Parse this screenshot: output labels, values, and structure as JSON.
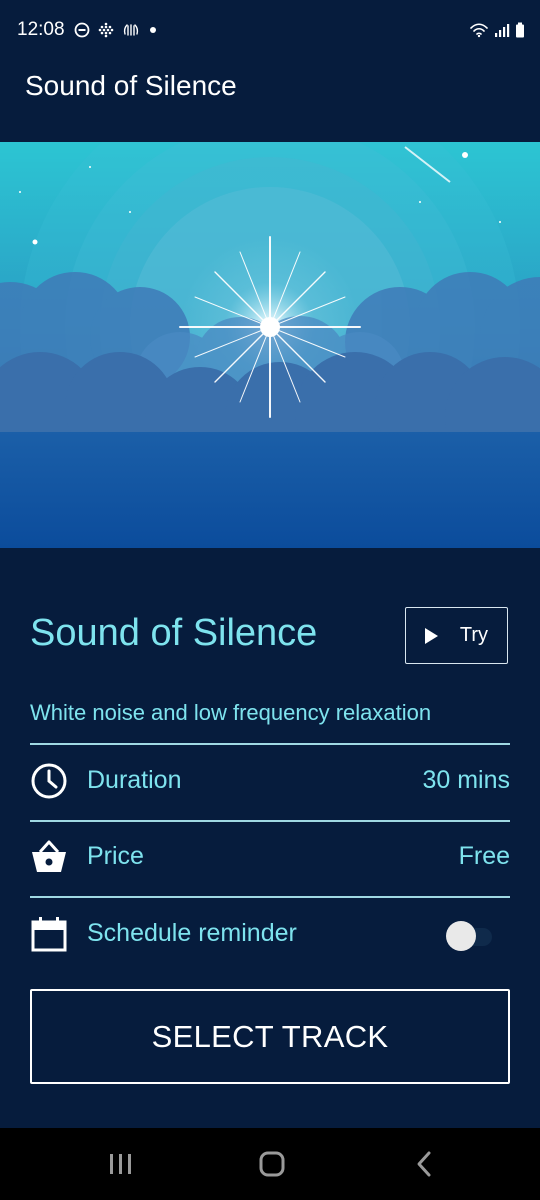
{
  "status_bar": {
    "time": "12:08",
    "left_icons": [
      "do-not-disturb-icon",
      "app-grid-icon",
      "hand-icon",
      "dot-icon"
    ],
    "right_icons": [
      "wifi-icon",
      "signal-icon",
      "battery-icon"
    ]
  },
  "app_bar": {
    "title": "Sound of Silence"
  },
  "hero": {
    "icon": "starburst-clouds-illustration"
  },
  "track": {
    "title": "Sound of Silence",
    "try_label": "Try",
    "description": "White noise and low frequency relaxation"
  },
  "details": {
    "duration_label": "Duration",
    "duration_value": "30 mins",
    "price_label": "Price",
    "price_value": "Free",
    "reminder_label": "Schedule reminder",
    "reminder_enabled": false
  },
  "actions": {
    "select_label": "SELECT TRACK"
  },
  "nav": {
    "items": [
      "recents-icon",
      "home-icon",
      "back-icon"
    ]
  },
  "colors": {
    "background": "#061c3d",
    "accent": "#7ee3ee",
    "divider": "#9fd8e3"
  }
}
